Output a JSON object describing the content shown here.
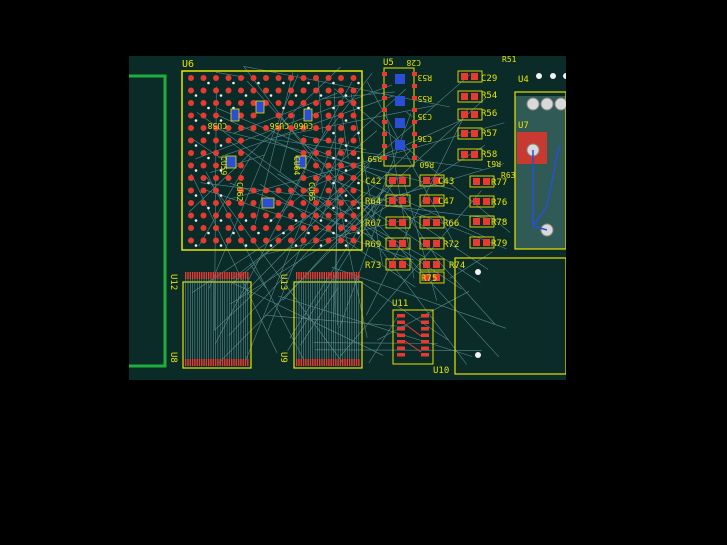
{
  "colors": {
    "background": "#000000",
    "board": "#0a2b28",
    "silkscreen": "#e8e400",
    "pad": "#e83a30",
    "via": "#f2f2f2",
    "blue_part": "#2a4fd6",
    "rats": "#6aa0a6",
    "copper_green": "#1fae3c",
    "copper_pour": "#2f5a55",
    "highlight_pad": "#e8832a"
  },
  "labels": {
    "u6": "U6",
    "u5": "U5",
    "u4": "U4",
    "u7": "U7",
    "u8": "U8",
    "u9": "U9",
    "u10": "U10",
    "u11": "U11",
    "u12": "U12",
    "u13": "U13",
    "c28": "C28",
    "c29": "C29",
    "c35": "C35",
    "c36": "C36",
    "c42": "C42",
    "c43": "C43",
    "c47": "C47",
    "r51": "R51",
    "r53": "R53",
    "r54": "R54",
    "r55": "R55",
    "r56": "R56",
    "r57": "R57",
    "r58": "R58",
    "r59": "R59",
    "r60": "R60",
    "r61": "R61",
    "r63": "R63",
    "r64": "R64",
    "r66": "R66",
    "r67": "R67",
    "r69": "R69",
    "r72": "R72",
    "r73": "R73",
    "r74": "R74",
    "r75": "R75",
    "r76": "R76",
    "r77": "R77",
    "r78": "R78",
    "r79": "R79",
    "cu56": "CU56",
    "cu58": "CU58",
    "cu59": "CU59",
    "cu60": "CU60",
    "cu62": "CU62",
    "cu64": "CU64",
    "cu65": "CU65"
  }
}
